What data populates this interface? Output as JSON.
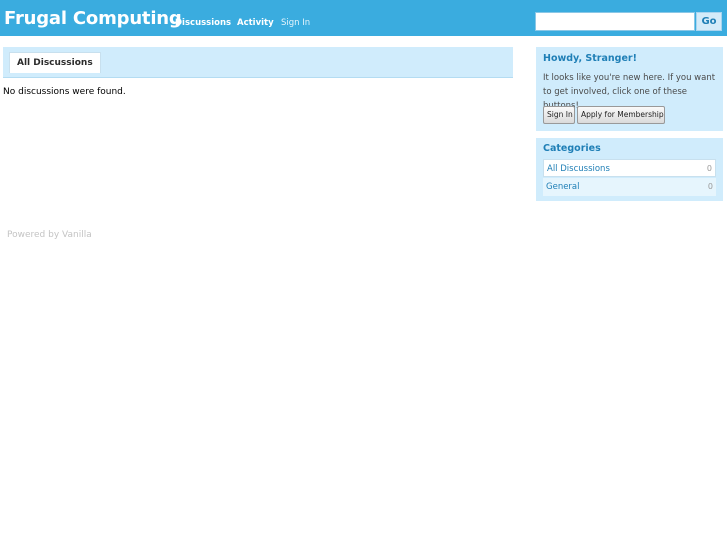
{
  "header": {
    "site_title": "Frugal Computing",
    "nav": [
      "Discussions",
      "Activity",
      "Sign In"
    ],
    "search": {
      "placeholder": "",
      "button": "Go"
    }
  },
  "main": {
    "tab_label": "All Discussions",
    "empty_message": "No discussions were found."
  },
  "footer": {
    "text": "Powered by Vanilla"
  },
  "sidebar": {
    "welcome": {
      "title": "Howdy, Stranger!",
      "text": "It looks like you're new here. If you want to get involved, click one of these buttons!",
      "sign_in_label": "Sign In",
      "apply_label": "Apply for Membership"
    },
    "categories": {
      "title": "Categories",
      "items": [
        {
          "name": "All Discussions",
          "count": "0"
        },
        {
          "name": "General",
          "count": "0"
        }
      ]
    }
  },
  "colors": {
    "header_bg": "#3aacdf",
    "panel_bg": "#d0ecfc",
    "link": "#1f7fb6"
  }
}
